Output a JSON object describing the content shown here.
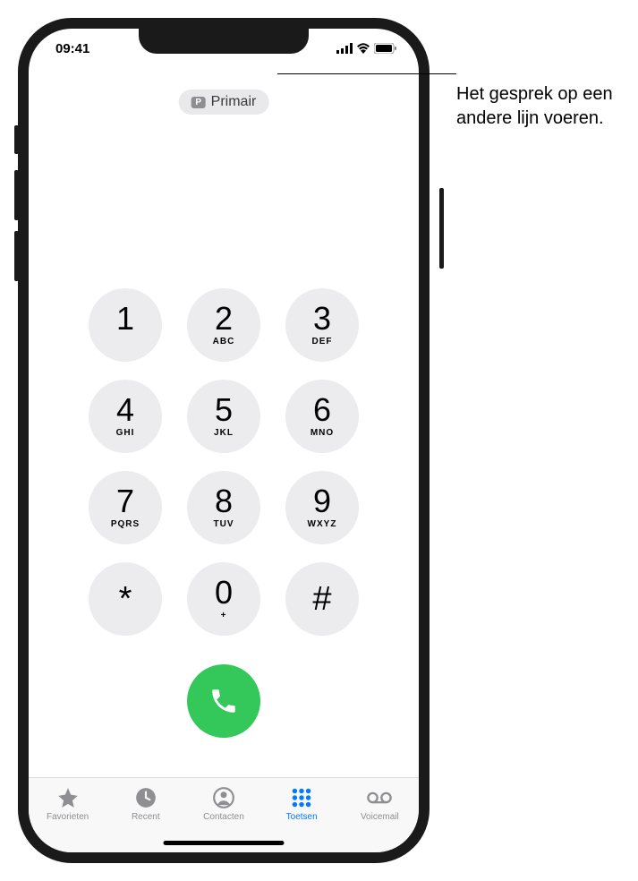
{
  "status": {
    "time": "09:41"
  },
  "line_selector": {
    "badge": "P",
    "label": "Primair"
  },
  "keypad": [
    {
      "digit": "1",
      "letters": ""
    },
    {
      "digit": "2",
      "letters": "ABC"
    },
    {
      "digit": "3",
      "letters": "DEF"
    },
    {
      "digit": "4",
      "letters": "GHI"
    },
    {
      "digit": "5",
      "letters": "JKL"
    },
    {
      "digit": "6",
      "letters": "MNO"
    },
    {
      "digit": "7",
      "letters": "PQRS"
    },
    {
      "digit": "8",
      "letters": "TUV"
    },
    {
      "digit": "9",
      "letters": "WXYZ"
    },
    {
      "digit": "*",
      "letters": "",
      "symbol": true
    },
    {
      "digit": "0",
      "letters": "+"
    },
    {
      "digit": "#",
      "letters": "",
      "symbol": true
    }
  ],
  "tabs": {
    "favorites": "Favorieten",
    "recent": "Recent",
    "contacts": "Contacten",
    "keypad": "Toetsen",
    "voicemail": "Voicemail"
  },
  "callout": {
    "text": "Het gesprek op een andere lijn voeren."
  }
}
